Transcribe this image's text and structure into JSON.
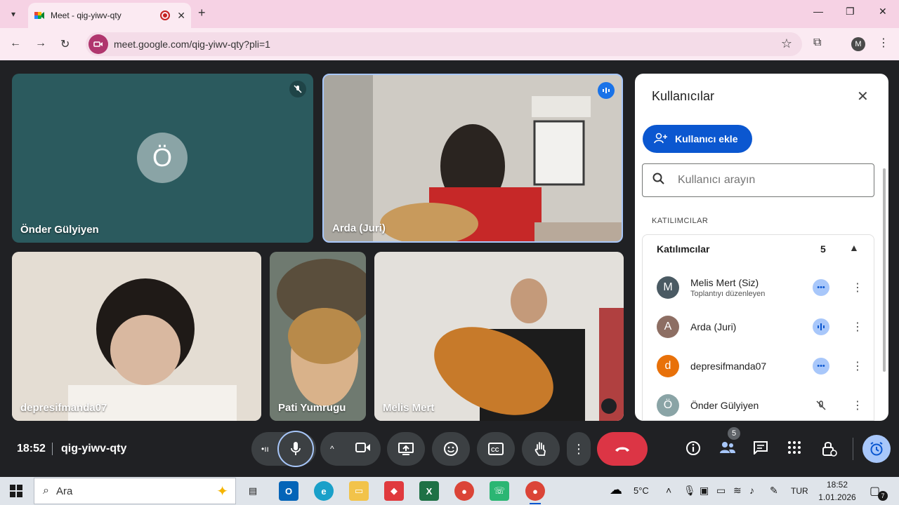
{
  "browser": {
    "tab_title": "Meet - qig-yiwv-qty",
    "url": "meet.google.com/qig-yiwv-qty?pli=1",
    "profile_initial": "M"
  },
  "tiles": [
    {
      "name": "Önder Gülyiyen",
      "avatar": "Ö",
      "muted": true
    },
    {
      "name": "Arda (Juri)",
      "speaking": true
    },
    {
      "name": "depresifmanda07"
    },
    {
      "name": "Pati Yumrugu"
    },
    {
      "name": "Melis Mert"
    }
  ],
  "panel": {
    "title": "Kullanıcılar",
    "add_label": "Kullanıcı ekle",
    "search_placeholder": "Kullanıcı arayın",
    "section_label": "KATILIMCILAR",
    "group_label": "Katılımcılar",
    "group_count": "5",
    "participants": [
      {
        "initial": "M",
        "name": "Melis Mert (Siz)",
        "role": "Toplantıyı düzenleyen",
        "color": "#4a5a63",
        "status": "idle"
      },
      {
        "initial": "A",
        "name": "Arda (Juri)",
        "role": "",
        "color": "#8d6e63",
        "status": "speaking"
      },
      {
        "initial": "d",
        "name": "depresifmanda07",
        "role": "",
        "color": "#e8710a",
        "status": "idle"
      },
      {
        "initial": "Ö",
        "name": "Önder Gülyiyen",
        "role": "",
        "color": "#8aa4a6",
        "status": "muted"
      }
    ]
  },
  "meeting": {
    "time": "18:52",
    "code": "qig-yiwv-qty",
    "people_count": "5"
  },
  "colors": {
    "accent": "#0b57d0",
    "end_call": "#dc3545",
    "tab_bar": "#f6d2e4"
  },
  "taskbar": {
    "search_placeholder": "Ara",
    "temperature": "5°C",
    "language": "TUR",
    "time": "18:52",
    "date": "1.01.2026",
    "notification_count": "7"
  }
}
